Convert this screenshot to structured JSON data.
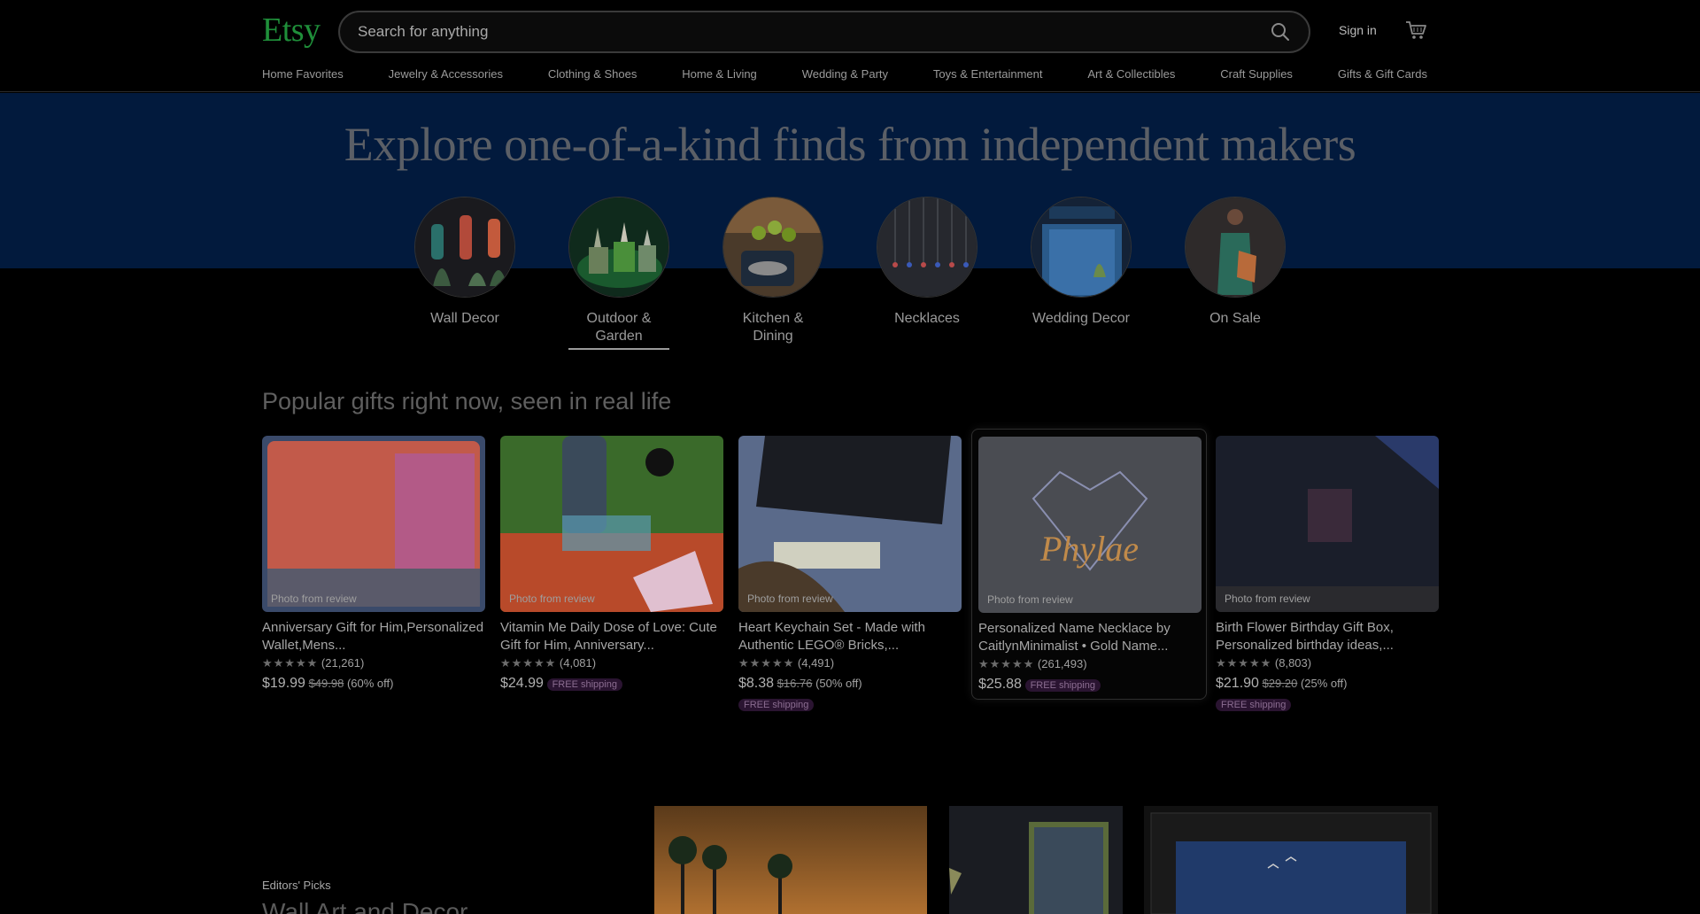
{
  "header": {
    "logo": "Etsy",
    "search_placeholder": "Search for anything",
    "signin": "Sign in"
  },
  "categories": [
    "Home Favorites",
    "Jewelry & Accessories",
    "Clothing & Shoes",
    "Home & Living",
    "Wedding & Party",
    "Toys & Entertainment",
    "Art & Collectibles",
    "Craft Supplies",
    "Gifts & Gift Cards"
  ],
  "hero": {
    "title": "Explore one-of-a-kind finds from independent makers",
    "circles": [
      {
        "label": "Wall Decor"
      },
      {
        "label": "Outdoor & Garden",
        "active": true
      },
      {
        "label": "Kitchen & Dining"
      },
      {
        "label": "Necklaces"
      },
      {
        "label": "Wedding Decor"
      },
      {
        "label": "On Sale"
      }
    ]
  },
  "popular": {
    "title": "Popular gifts right now, seen in real life",
    "photo_badge": "Photo from review",
    "items": [
      {
        "title": "Anniversary Gift for Him,Personalized Wallet,Mens...",
        "stars": "★★★★★",
        "reviews": "(21,261)",
        "price": "$19.99",
        "old_price": "$49.98",
        "discount": "(60% off)",
        "free_shipping": ""
      },
      {
        "title": "Vitamin Me Daily Dose of Love: Cute Gift for Him, Anniversary...",
        "stars": "★★★★★",
        "reviews": "(4,081)",
        "price": "$24.99",
        "old_price": "",
        "discount": "",
        "free_shipping": "FREE shipping"
      },
      {
        "title": "Heart Keychain Set - Made with Authentic LEGO® Bricks,...",
        "stars": "★★★★★",
        "reviews": "(4,491)",
        "price": "$8.38",
        "old_price": "$16.76",
        "discount": "(50% off)",
        "free_shipping": "FREE shipping"
      },
      {
        "title": "Personalized Name Necklace by CaitlynMinimalist • Gold Name...",
        "stars": "★★★★★",
        "reviews": "(261,493)",
        "price": "$25.88",
        "old_price": "",
        "discount": "",
        "free_shipping": "FREE shipping"
      },
      {
        "title": "Birth Flower Birthday Gift Box, Personalized birthday ideas,...",
        "stars": "★★★★★",
        "reviews": "(8,803)",
        "price": "$21.90",
        "old_price": "$29.20",
        "discount": "(25% off)",
        "free_shipping": "FREE shipping"
      }
    ]
  },
  "editors": {
    "label": "Editors' Picks",
    "title": "Wall Art and Decor"
  },
  "colors": {
    "brand": "#1f8f3a",
    "hero_band": "#021a3d",
    "free_badge_bg": "#2a1431"
  }
}
